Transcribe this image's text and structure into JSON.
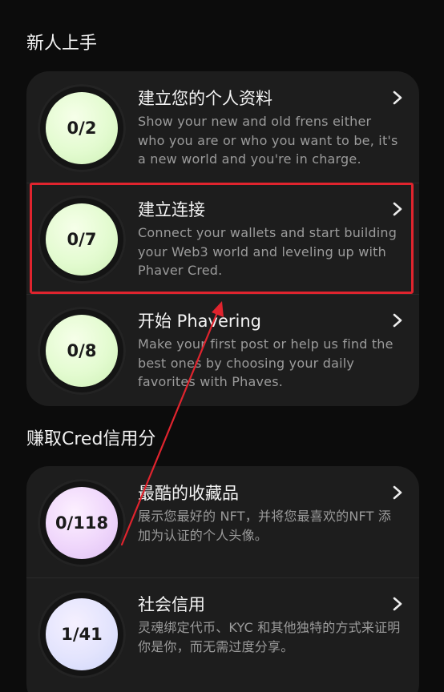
{
  "sections": [
    {
      "title": "新人上手",
      "items": [
        {
          "progress": "0/2",
          "title": "建立您的个人资料",
          "description": "Show your new and old frens either who you are or who you want to be, it's a new world and you're in charge."
        },
        {
          "progress": "0/7",
          "title": "建立连接",
          "description": "Connect your wallets and start building your Web3 world and leveling up with Phaver Cred."
        },
        {
          "progress": "0/8",
          "title": "开始 Phavering",
          "description": "Make your first post or help us find the best ones by choosing your daily favorites with Phaves."
        }
      ]
    },
    {
      "title": "赚取Cred信用分",
      "items": [
        {
          "progress": "0/118",
          "title": "最酷的收藏品",
          "description": "展示您最好的 NFT，并将您最喜欢的NFT 添加为认证的个人头像。"
        },
        {
          "progress": "1/41",
          "title": "社会信用",
          "description": "灵魂绑定代币、KYC 和其他独特的方式来证明你是你，而无需过度分享。"
        }
      ]
    }
  ],
  "colors": {
    "highlight": "#e0242e",
    "arrow": "#e0242e",
    "background": "#0c0c0c",
    "card": "#1d1d1d"
  }
}
